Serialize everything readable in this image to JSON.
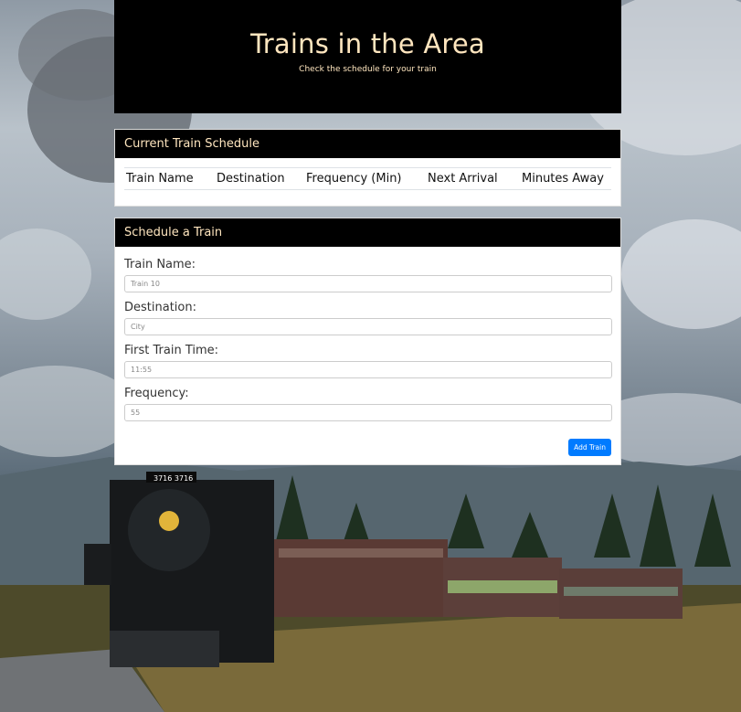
{
  "header": {
    "title": "Trains in the Area",
    "subtitle": "Check the schedule for your train"
  },
  "schedule": {
    "heading": "Current Train Schedule",
    "columns": [
      "Train Name",
      "Destination",
      "Frequency (Min)",
      "Next Arrival",
      "Minutes Away"
    ]
  },
  "form": {
    "heading": "Schedule a Train",
    "fields": [
      {
        "label": "Train Name:",
        "placeholder": "Train 10"
      },
      {
        "label": "Destination:",
        "placeholder": "City"
      },
      {
        "label": "First Train Time:",
        "placeholder": "11:55"
      },
      {
        "label": "Frequency:",
        "placeholder": "55"
      }
    ],
    "submit_label": "Add Train"
  },
  "background": {
    "locomotive_number": "3716 3716"
  }
}
